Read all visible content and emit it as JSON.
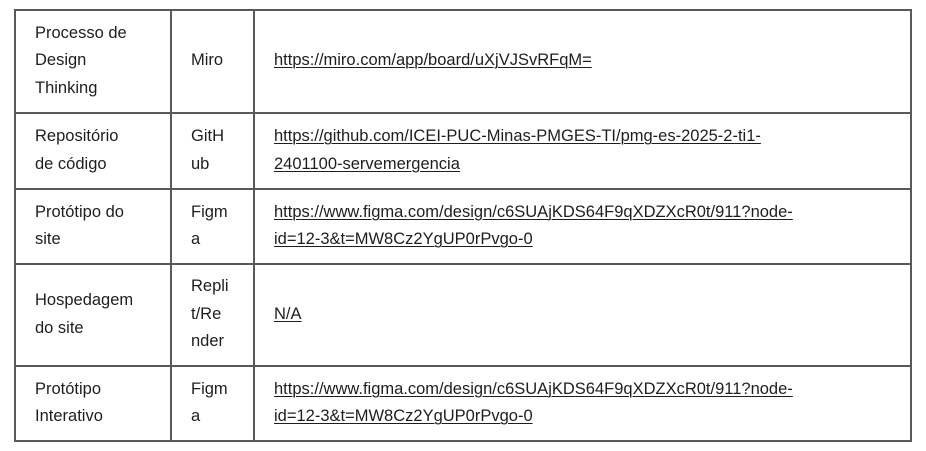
{
  "table": {
    "rows": [
      {
        "name": "Processo de\nDesign\nThinking",
        "tool": "Miro",
        "link": "https://miro.com/app/board/uXjVJSvRFqM="
      },
      {
        "name": "Repositório\nde código",
        "tool": "GitH\nub",
        "link": "https://github.com/ICEI-PUC-Minas-PMGES-TI/pmg-es-2025-2-ti1-\n2401100-servemergencia"
      },
      {
        "name": "Protótipo do\nsite",
        "tool": "Figm\na",
        "link": "https://www.figma.com/design/c6SUAjKDS64F9qXDZXcR0t/911?node-\nid=12-3&t=MW8Cz2YgUP0rPvgo-0"
      },
      {
        "name": "Hospedagem\ndo site",
        "tool": "Repli\nt/Re\nnder",
        "link": "N/A"
      },
      {
        "name": "Protótipo\nInterativo",
        "tool": "Figm\na",
        "link": "https://www.figma.com/design/c6SUAjKDS64F9qXDZXcR0t/911?node-\nid=12-3&t=MW8Cz2YgUP0rPvgo-0"
      }
    ]
  }
}
